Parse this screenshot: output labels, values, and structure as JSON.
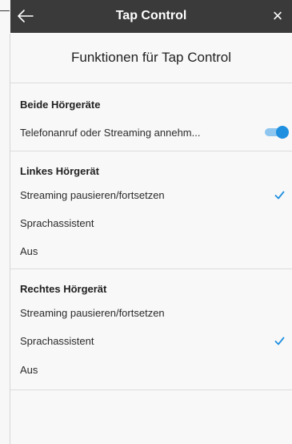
{
  "header": {
    "title": "Tap Control",
    "back_icon": "arrow-left-icon",
    "close_icon": "close-icon",
    "close_glyph": "×"
  },
  "page_heading": "Funktionen für Tap Control",
  "sections": [
    {
      "title": "Beide Hörgeräte",
      "rows": [
        {
          "label": "Telefonanruf oder Streaming annehm...",
          "control": "toggle",
          "checked": true
        }
      ]
    },
    {
      "title": "Linkes Hörgerät",
      "rows": [
        {
          "label": "Streaming pausieren/fortsetzen",
          "checked": true
        },
        {
          "label": "Sprachassistent",
          "checked": false
        },
        {
          "label": "Aus",
          "checked": false
        }
      ]
    },
    {
      "title": "Rechtes Hörgerät",
      "rows": [
        {
          "label": "Streaming pausieren/fortsetzen",
          "checked": false
        },
        {
          "label": "Sprachassistent",
          "checked": true
        },
        {
          "label": "Aus",
          "checked": false
        }
      ]
    }
  ],
  "colors": {
    "header_bg": "#3a3a3a",
    "accent": "#1f8fe0",
    "divider": "#dcdcdc"
  }
}
